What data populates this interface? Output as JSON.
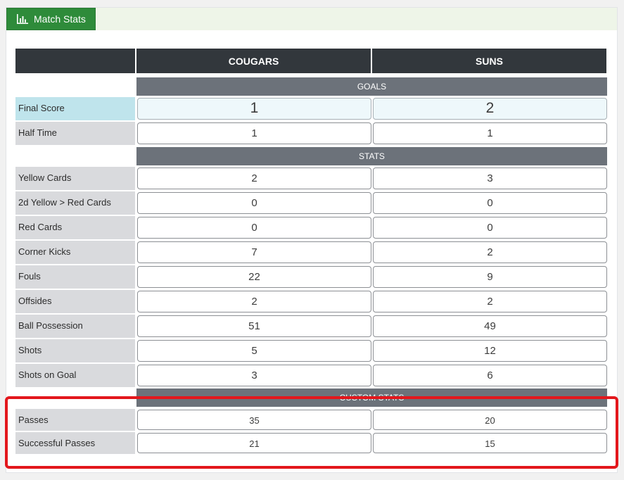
{
  "panel": {
    "tab_label": "Match Stats",
    "tab_icon": "bar-chart-icon"
  },
  "teams": {
    "home": "COUGARS",
    "away": "SUNS"
  },
  "sections": {
    "goals": "GOALS",
    "stats": "STATS",
    "custom": "CUSTOM STATS"
  },
  "goals": [
    {
      "label": "Final Score",
      "home": "1",
      "away": "2"
    },
    {
      "label": "Half Time",
      "home": "1",
      "away": "1"
    }
  ],
  "stats": [
    {
      "label": "Yellow Cards",
      "home": "2",
      "away": "3"
    },
    {
      "label": "2d Yellow > Red Cards",
      "home": "0",
      "away": "0"
    },
    {
      "label": "Red Cards",
      "home": "0",
      "away": "0"
    },
    {
      "label": "Corner Kicks",
      "home": "7",
      "away": "2"
    },
    {
      "label": "Fouls",
      "home": "22",
      "away": "9"
    },
    {
      "label": "Offsides",
      "home": "2",
      "away": "2"
    },
    {
      "label": "Ball Possession",
      "home": "51",
      "away": "49"
    },
    {
      "label": "Shots",
      "home": "5",
      "away": "12"
    },
    {
      "label": "Shots on Goal",
      "home": "3",
      "away": "6"
    }
  ],
  "custom": [
    {
      "label": "Passes",
      "home": "35",
      "away": "20"
    },
    {
      "label": "Successful Passes",
      "home": "21",
      "away": "15"
    }
  ],
  "colors": {
    "accent": "#2e8b3a",
    "header": "#32373c",
    "section": "#6c727a",
    "highlight_box": "#e3171c"
  }
}
